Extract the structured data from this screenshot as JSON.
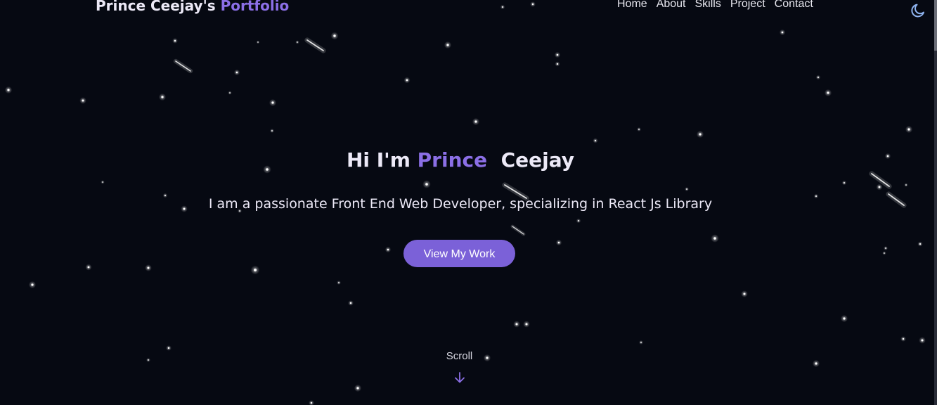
{
  "header": {
    "brand_prefix": "Prince Ceejay's",
    "brand_accent": "Portfolio",
    "nav": [
      "Home",
      "About",
      "Skills",
      "Project",
      "Contact"
    ],
    "theme_icon": "moon-icon"
  },
  "hero": {
    "greeting": "Hi I'm",
    "first_name": "Prince",
    "last_name": "Ceejay",
    "tagline": "I am a passionate Front End Web Developer, specializing in React Js Library",
    "cta_label": "View My Work"
  },
  "scroll": {
    "label": "Scroll",
    "icon": "arrow-down-icon"
  },
  "colors": {
    "background": "#060912",
    "accent": "#8b6fe6",
    "button": "#7b61d8",
    "text": "#ece9f7",
    "toggle_icon": "#8fb4f0"
  }
}
